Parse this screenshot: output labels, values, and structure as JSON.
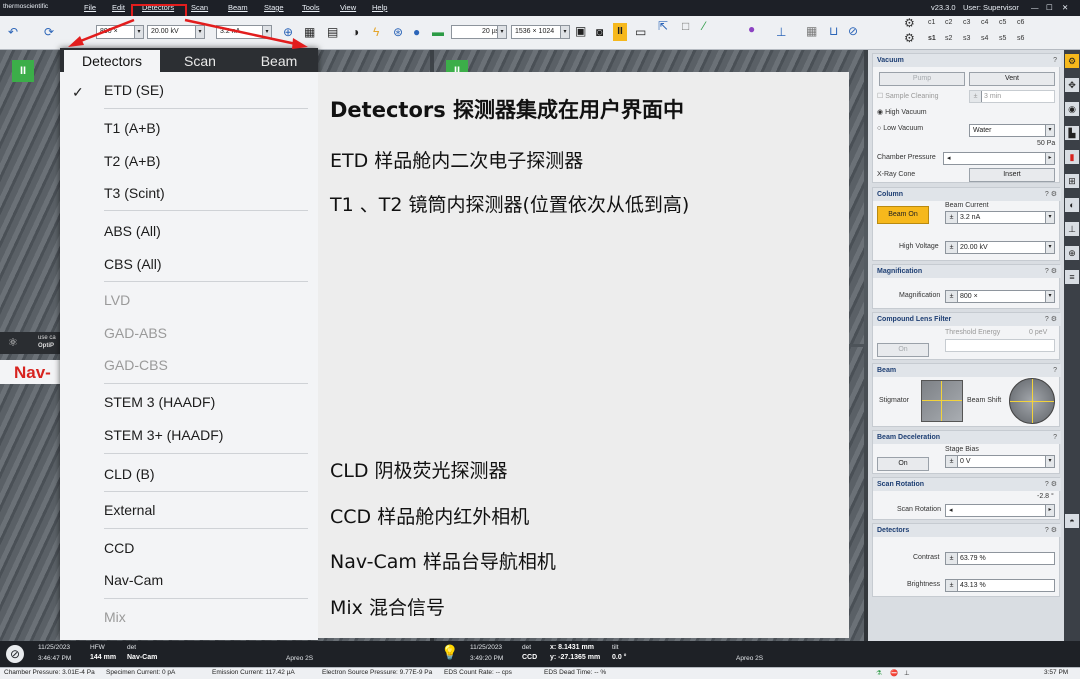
{
  "title_bar": {
    "brand": "thermoscientific",
    "menu": [
      "File",
      "Edit",
      "Detectors",
      "Scan",
      "Beam",
      "Stage",
      "Tools",
      "View",
      "Help"
    ],
    "version": "v23.3.0",
    "user": "User: Supervisor"
  },
  "toolbar": {
    "mag": "800 ×",
    "hv": "20.00 kV",
    "current": "3.2 nA",
    "dwell": "20 µs",
    "resolution": "1536 × 1024",
    "c_labels": [
      "c1",
      "c2",
      "c3",
      "c4",
      "c5",
      "c6"
    ],
    "s_labels": [
      "s1",
      "s2",
      "s3",
      "s4",
      "s5",
      "s6"
    ]
  },
  "menu": {
    "tabs": [
      "Detectors",
      "Scan",
      "Beam"
    ],
    "checked": "✓",
    "items": [
      {
        "label": "ETD (SE)",
        "disabled": false
      },
      {
        "label": "T1 (A+B)",
        "disabled": false
      },
      {
        "label": "T2 (A+B)",
        "disabled": false
      },
      {
        "label": "T3 (Scint)",
        "disabled": false
      },
      {
        "label": "ABS (All)",
        "disabled": false
      },
      {
        "label": "CBS (All)",
        "disabled": false
      },
      {
        "label": "LVD",
        "disabled": true
      },
      {
        "label": "GAD-ABS",
        "disabled": true
      },
      {
        "label": "GAD-CBS",
        "disabled": true
      },
      {
        "label": "STEM 3 (HAADF)",
        "disabled": false
      },
      {
        "label": "STEM 3+ (HAADF)",
        "disabled": false
      },
      {
        "label": "CLD (B)",
        "disabled": false
      },
      {
        "label": "External",
        "disabled": false
      },
      {
        "label": "CCD",
        "disabled": false
      },
      {
        "label": "Nav-Cam",
        "disabled": false
      },
      {
        "label": "Mix",
        "disabled": true
      }
    ]
  },
  "annotation": {
    "title": "Detectors 探测器集成在用户界面中",
    "lines": [
      "ETD 样品舱内二次电子探测器",
      "T1 、T2 镜筒内探测器(位置依次从低到高)",
      "CLD 阴极荧光探测器",
      "CCD 样品舱内红外相机",
      "Nav-Cam 样品台导航相机",
      "Mix 混合信号"
    ]
  },
  "left_bits": {
    "nav_label": "Nav-",
    "use_text": "use ca",
    "opti": "OptiP"
  },
  "right_panel": {
    "vacuum": {
      "title": "Vacuum",
      "q": "?",
      "pump": "Pump",
      "vent": "Vent",
      "sample_cleaning": "Sample Cleaning",
      "sc_time": "3 min",
      "high_vac": "High Vacuum",
      "low_vac": "Low Vacuum",
      "water": "Water",
      "pressure_val": "50 Pa",
      "chamber_pressure": "Chamber Pressure",
      "xray": "X-Ray Cone",
      "insert": "Insert"
    },
    "column": {
      "title": "Column",
      "beam_on": "Beam On",
      "beam_current": "Beam Current",
      "bc_val": "3.2 nA",
      "high_voltage": "High Voltage",
      "hv_val": "20.00 kV"
    },
    "magnification": {
      "title": "Magnification",
      "label": "Magnification",
      "val": "800 ×"
    },
    "clf": {
      "title": "Compound Lens Filter",
      "threshold": "Threshold Energy",
      "th_val": "0 peV",
      "on": "On"
    },
    "beam": {
      "title": "Beam",
      "stigmator": "Stigmator",
      "shift": "Beam Shift"
    },
    "decel": {
      "title": "Beam Deceleration",
      "stage_bias": "Stage Bias",
      "on": "On",
      "bias_val": "0 V"
    },
    "scanrot": {
      "title": "Scan Rotation",
      "val": "-2.8 °",
      "label": "Scan Rotation"
    },
    "detectors": {
      "title": "Detectors",
      "contrast": "Contrast",
      "contrast_val": "63.79 %",
      "brightness": "Brightness",
      "brightness_val": "43.13 %"
    }
  },
  "bottom": {
    "date1": "11/25/2023",
    "time1": "3:46:47 PM",
    "hfw_label": "HFW",
    "hfw_val": "144 mm",
    "det_label": "det",
    "det_val": "Nav-Cam",
    "apreo1": "Apreo 2S",
    "date2": "11/25/2023",
    "time2": "3:49:20 PM",
    "det2_val": "CCD",
    "x_val": "x: 8.1431 mm",
    "y_val": "y: -27.1365 mm",
    "tilt_label": "tilt",
    "tilt_val": "0.0 °",
    "apreo2": "Apreo 2S"
  },
  "status": {
    "chamber": "Chamber Pressure: 3.01E-4 Pa",
    "specimen": "Specimen Current: 0 pA",
    "emission": "Emission Current: 117.42 µA",
    "electron": "Electron Source Pressure: 9.77E-9 Pa",
    "eds_rate": "EDS Count Rate:    -- cps",
    "eds_dead": "EDS Dead Time:  -- %",
    "clock": "3:57 PM"
  }
}
